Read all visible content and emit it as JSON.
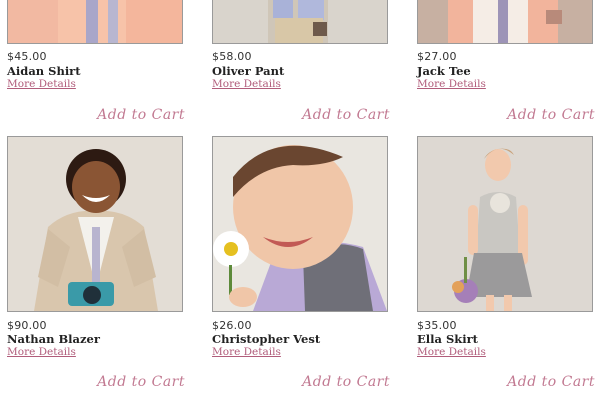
{
  "actions": {
    "more_details_label": "More Details",
    "add_to_cart_label": "Add to Cart"
  },
  "products": [
    {
      "price": "$45.00",
      "name": "Aidan Shirt"
    },
    {
      "price": "$58.00",
      "name": "Oliver Pant"
    },
    {
      "price": "$27.00",
      "name": "Jack Tee"
    },
    {
      "price": "$90.00",
      "name": "Nathan Blazer"
    },
    {
      "price": "$26.00",
      "name": "Christopher Vest"
    },
    {
      "price": "$35.00",
      "name": "Ella Skirt"
    }
  ],
  "colors": {
    "link": "#b15d7b",
    "add_to_cart": "#c27a92",
    "photo_border": "#9a9a9a"
  }
}
